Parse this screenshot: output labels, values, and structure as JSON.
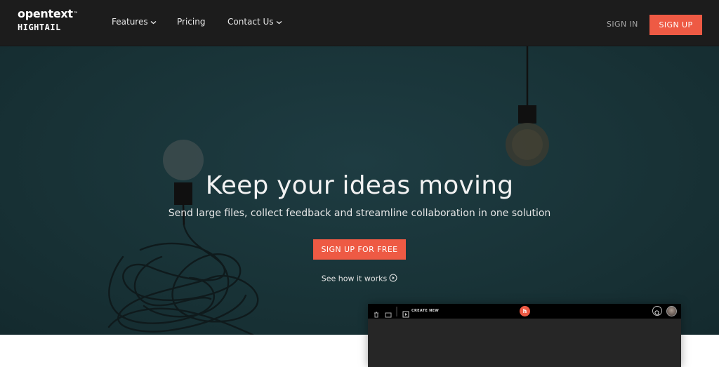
{
  "logo": {
    "top": "opentext",
    "tm": "™",
    "bottom": "HIGHTAIL"
  },
  "nav": {
    "features": "Features",
    "pricing": "Pricing",
    "contact": "Contact Us",
    "sign_in": "SIGN IN",
    "sign_up": "SIGN UP"
  },
  "hero": {
    "title": "Keep your ideas moving",
    "subtitle": "Send large files, collect feedback and streamline collaboration in one solution",
    "cta": "SIGN UP FOR FREE",
    "see_how": "See how it works"
  },
  "preview": {
    "create_new": "CREATE NEW",
    "badge": "h"
  },
  "icons": {
    "features_chevron": "chevron-down-icon",
    "contact_chevron": "chevron-down-icon",
    "play": "play-circle-icon",
    "search": "search-icon"
  },
  "colors": {
    "accent": "#ee5a44",
    "nav_bg": "#1c1c1c",
    "hero_bg": "#183236"
  }
}
